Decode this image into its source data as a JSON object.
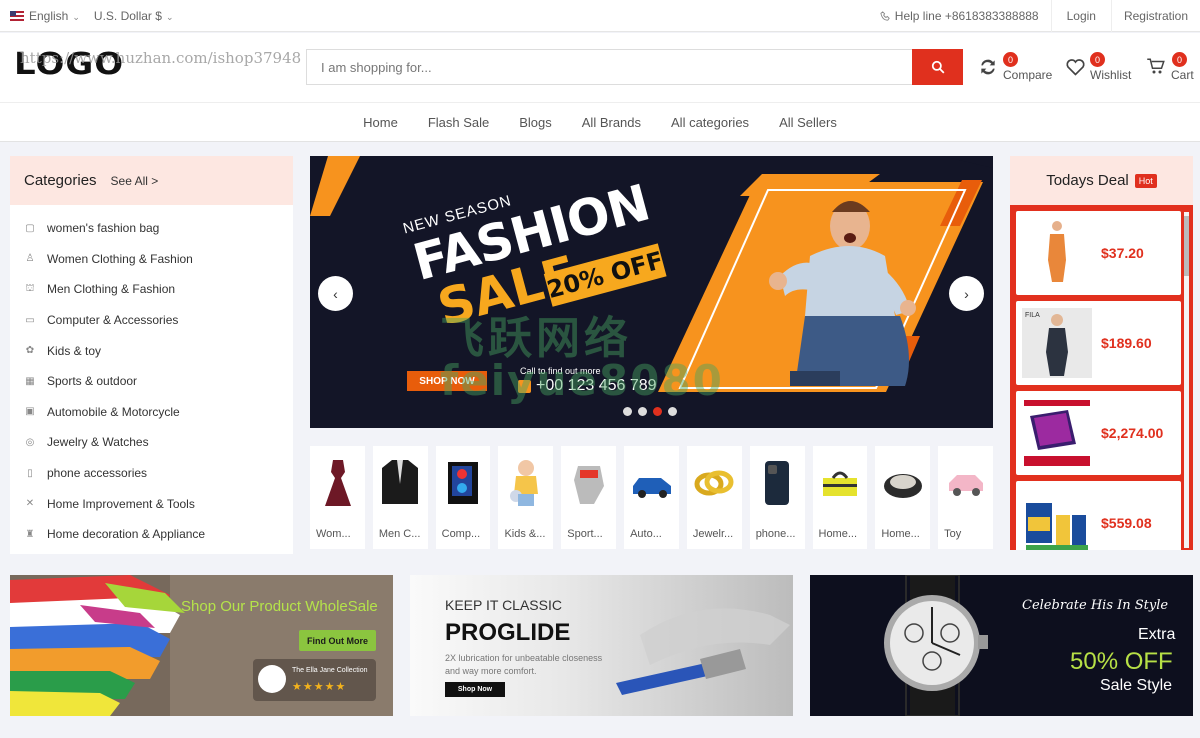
{
  "topbar": {
    "language": "English",
    "currency": "U.S. Dollar $",
    "helpline": "Help line +8618383388888",
    "login": "Login",
    "registration": "Registration"
  },
  "header": {
    "logo_text": "LOGO",
    "watermark_url": "https://www.huzhan.com/ishop37948",
    "search_placeholder": "I am shopping for...",
    "compare": {
      "label": "Compare",
      "count": "0"
    },
    "wishlist": {
      "label": "Wishlist",
      "count": "0"
    },
    "cart": {
      "label": "Cart",
      "count": "0"
    }
  },
  "nav": [
    "Home",
    "Flash Sale",
    "Blogs",
    "All Brands",
    "All categories",
    "All Sellers"
  ],
  "categories": {
    "title": "Categories",
    "see_all": "See All >",
    "items": [
      "women's fashion bag",
      "Women Clothing & Fashion",
      "Men Clothing & Fashion",
      "Computer & Accessories",
      "Kids & toy",
      "Sports & outdoor",
      "Automobile & Motorcycle",
      "Jewelry & Watches",
      "phone accessories",
      "Home Improvement & Tools",
      "Home decoration & Appliance"
    ]
  },
  "slider": {
    "line1": "NEW SEASON",
    "line2": "FASHION",
    "line3": "SALE",
    "discount": "20% OFF",
    "cta": "SHOP NOW",
    "call_label": "Call to find out more",
    "phone": "+00 123 456 789",
    "prev": "‹",
    "next": "›"
  },
  "category_cards": [
    "Wom...",
    "Men C...",
    "Comp...",
    "Kids &...",
    "Sport...",
    "Auto...",
    "Jewelr...",
    "phone...",
    "Home...",
    "Home...",
    "Toy"
  ],
  "todays_deal": {
    "title": "Todays Deal",
    "badge": "Hot",
    "prices": [
      "$37.20",
      "$189.60",
      "$2,274.00",
      "$559.08"
    ]
  },
  "banners": {
    "b1": {
      "headline": "Shop Our Product WholeSale",
      "button": "Find Out More",
      "collection": "The Ella Jane Collection",
      "stars": "★★★★★"
    },
    "b2": {
      "kicker": "KEEP IT CLASSIC",
      "title": "PROGLIDE",
      "text1": "2X lubrication for unbeatable closeness",
      "text2": "and way more comfort.",
      "button": "Shop Now"
    },
    "b3": {
      "script": "Celebrate His In Style",
      "extra": "Extra",
      "off": "50% OFF",
      "sale": "Sale Style"
    }
  },
  "watermark": {
    "line1": "飞跃网络",
    "line2": "feiyue8080"
  }
}
